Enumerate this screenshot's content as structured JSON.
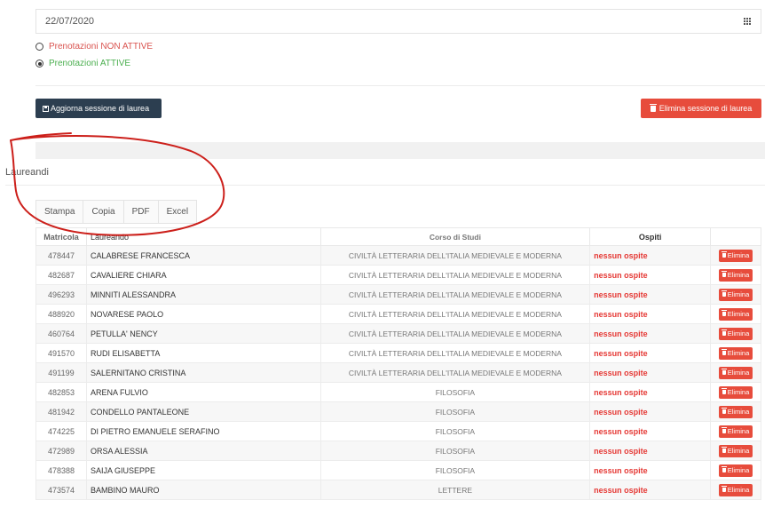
{
  "session": {
    "date": "22/07/2020",
    "option_inactive": "Prenotazioni NON ATTIVE",
    "option_active": "Prenotazioni ATTIVE",
    "active_selected": true,
    "update_label": "Aggiorna sessione di laurea",
    "delete_label": "Elimina sessione di laurea"
  },
  "section": {
    "title": "Laureandi"
  },
  "export": [
    "Stampa",
    "Copia",
    "PDF",
    "Excel"
  ],
  "table": {
    "headers": [
      "Matricola",
      "Laureando",
      "Corso di Studi",
      "Ospiti",
      ""
    ],
    "delete_label": "Elimina",
    "rows": [
      {
        "matricola": "478447",
        "nome": "CALABRESE FRANCESCA",
        "corso": "CIVILTÀ LETTERARIA DELL'ITALIA MEDIEVALE E MODERNA",
        "ospiti": "nessun ospite"
      },
      {
        "matricola": "482687",
        "nome": "CAVALIERE CHIARA",
        "corso": "CIVILTÀ LETTERARIA DELL'ITALIA MEDIEVALE E MODERNA",
        "ospiti": "nessun ospite"
      },
      {
        "matricola": "496293",
        "nome": "MINNITI ALESSANDRA",
        "corso": "CIVILTÀ LETTERARIA DELL'ITALIA MEDIEVALE E MODERNA",
        "ospiti": "nessun ospite"
      },
      {
        "matricola": "488920",
        "nome": "NOVARESE PAOLO",
        "corso": "CIVILTÀ LETTERARIA DELL'ITALIA MEDIEVALE E MODERNA",
        "ospiti": "nessun ospite"
      },
      {
        "matricola": "460764",
        "nome": "PETULLA' NENCY",
        "corso": "CIVILTÀ LETTERARIA DELL'ITALIA MEDIEVALE E MODERNA",
        "ospiti": "nessun ospite"
      },
      {
        "matricola": "491570",
        "nome": "RUDI ELISABETTA",
        "corso": "CIVILTÀ LETTERARIA DELL'ITALIA MEDIEVALE E MODERNA",
        "ospiti": "nessun ospite"
      },
      {
        "matricola": "491199",
        "nome": "SALERNITANO CRISTINA",
        "corso": "CIVILTÀ LETTERARIA DELL'ITALIA MEDIEVALE E MODERNA",
        "ospiti": "nessun ospite"
      },
      {
        "matricola": "482853",
        "nome": "ARENA FULVIO",
        "corso": "FILOSOFIA",
        "ospiti": "nessun ospite"
      },
      {
        "matricola": "481942",
        "nome": "CONDELLO PANTALEONE",
        "corso": "FILOSOFIA",
        "ospiti": "nessun ospite"
      },
      {
        "matricola": "474225",
        "nome": "DI PIETRO EMANUELE SERAFINO",
        "corso": "FILOSOFIA",
        "ospiti": "nessun ospite"
      },
      {
        "matricola": "472989",
        "nome": "ORSA ALESSIA",
        "corso": "FILOSOFIA",
        "ospiti": "nessun ospite"
      },
      {
        "matricola": "478388",
        "nome": "SAIJA GIUSEPPE",
        "corso": "FILOSOFIA",
        "ospiti": "nessun ospite"
      },
      {
        "matricola": "473574",
        "nome": "BAMBINO MAURO",
        "corso": "LETTERE",
        "ospiti": "nessun ospite"
      }
    ]
  },
  "colors": {
    "dark_button": "#2c3e50",
    "danger": "#e74c3c",
    "inactive_text": "#d9534f",
    "active_text": "#4caf50",
    "annotation": "#cc1f1a"
  }
}
